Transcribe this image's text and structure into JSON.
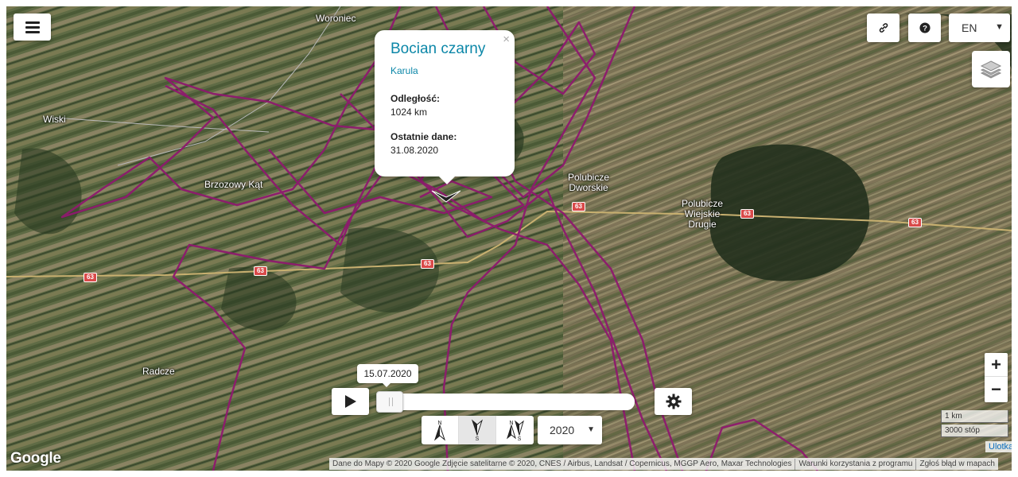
{
  "toolbar": {
    "menu_icon": "menu-icon",
    "link_icon": "link-icon",
    "help_icon": "question-circle-icon",
    "language": "EN",
    "layers_icon": "layers-icon"
  },
  "zoom": {
    "in_label": "+",
    "out_label": "−"
  },
  "popup": {
    "title": "Bocian czarny",
    "subtitle": "Karula",
    "distance_label": "Odległość:",
    "distance_value": "1024 km",
    "last_data_label": "Ostatnie dane:",
    "last_data_value": "31.08.2020",
    "close_label": "×"
  },
  "playback": {
    "current_date": "15.07.2020",
    "progress": 0,
    "play_icon": "play-icon",
    "settings_icon": "gear-icon",
    "year": "2020",
    "direction_buttons": [
      {
        "name": "north",
        "top": "N",
        "bottom": ""
      },
      {
        "name": "south",
        "top": "",
        "bottom": "S"
      },
      {
        "name": "north-south",
        "top": "N",
        "bottom": "S"
      }
    ]
  },
  "map": {
    "places": [
      {
        "name": "Woroniec"
      },
      {
        "name": "Wiski"
      },
      {
        "name": "Brzozowy Kąt"
      },
      {
        "name": "Polubicze Dworskie"
      },
      {
        "name": "Polubicze Wiejskie Drugie"
      },
      {
        "name": "Radcze"
      }
    ],
    "road_number": "63",
    "track_color": "#8e1a6e"
  },
  "scale": {
    "metric": "1 km",
    "imperial": "3000 stóp"
  },
  "attribution": {
    "google": "Google",
    "data": "Dane do Mapy © 2020 Google Zdjęcie satelitarne © 2020, CNES / Airbus, Landsat / Copernicus, MGGP Aero, Maxar Technologies",
    "terms": "Warunki korzystania z programu",
    "report": "Zgłoś błąd w mapach",
    "leaflet": "Ulotka"
  }
}
